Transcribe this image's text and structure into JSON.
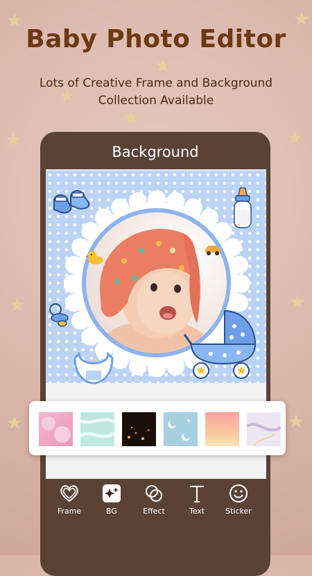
{
  "promo": {
    "title": "Baby Photo Editor",
    "subtitle_line1": "Lots of Creative Frame and Background",
    "subtitle_line2": "Collection Available"
  },
  "screen": {
    "header_title": "Background"
  },
  "backgrounds": [
    {
      "name": "pink-clouds"
    },
    {
      "name": "mint-marble"
    },
    {
      "name": "dark-bokeh"
    },
    {
      "name": "blue-moons"
    },
    {
      "name": "sunset-sky"
    },
    {
      "name": "pastel-marble"
    }
  ],
  "toolbar": {
    "frame": "Frame",
    "bg": "BG",
    "effect": "Effect",
    "text": "Text",
    "sticker": "Sticker"
  },
  "colors": {
    "title_brown": "#6a3a12",
    "phone_body": "#5a4335",
    "frame_blue": "#bcd3f6",
    "star_gold": "#e7cf9c"
  }
}
